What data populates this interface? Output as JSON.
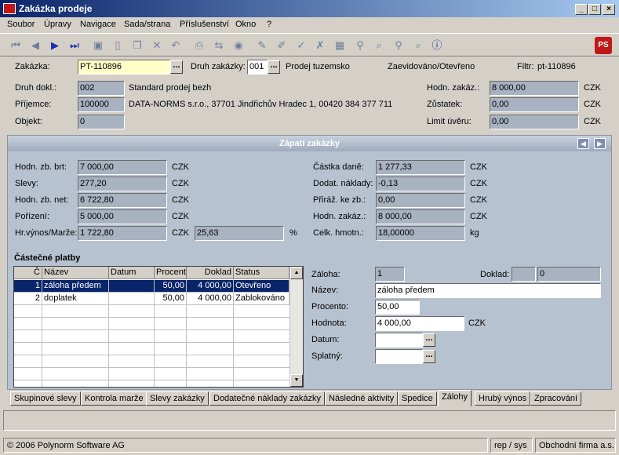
{
  "window": {
    "title": "Zakázka prodeje"
  },
  "menu": [
    "Soubor",
    "Úpravy",
    "Navigace",
    "Sada/strana",
    "Příslušenství",
    "Okno",
    "?"
  ],
  "header": {
    "zakazka_label": "Zakázka:",
    "zakazka_value": "PT-110896",
    "druh_zakazky_label": "Druh zakázky:",
    "druh_zakazky_value": "001",
    "druh_zakazky_text": "Prodej tuzemsko",
    "status_text": "Zaevidováno/Otevřeno",
    "filtr_label": "Filtr:",
    "filtr_value": "pt-110896",
    "druh_dokl_label": "Druh dokl.:",
    "druh_dokl_value": "002",
    "druh_dokl_text": "Standard prodej bezh",
    "prijemce_label": "Příjemce:",
    "prijemce_value": "100000",
    "prijemce_text": "DATA-NORMS s.r.o., 37701 Jindřichův Hradec 1, 00420 384 377 711",
    "objekt_label": "Objekt:",
    "objekt_value": "0",
    "hodn_zakaz_label": "Hodn. zakáz.:",
    "hodn_zakaz_value": "8 000,00",
    "zustatek_label": "Zůstatek:",
    "zustatek_value": "0,00",
    "limit_uveru_label": "Limit úvěru:",
    "limit_uveru_value": "0,00",
    "currency": "CZK"
  },
  "footer_panel": {
    "title": "Zápatí zakázky",
    "left": [
      {
        "label": "Hodn. zb. brt:",
        "value": "7 000,00",
        "unit": "CZK"
      },
      {
        "label": "Slevy:",
        "value": "277,20",
        "unit": "CZK"
      },
      {
        "label": "Hodn. zb. net:",
        "value": "6 722,80",
        "unit": "CZK"
      },
      {
        "label": "Pořízení:",
        "value": "5 000,00",
        "unit": "CZK"
      },
      {
        "label": "Hr.výnos/Marže:",
        "value": "1 722,80",
        "unit": "CZK"
      }
    ],
    "marze_pct": "25,63",
    "pct_sign": "%",
    "right": [
      {
        "label": "Částka daně:",
        "value": "1 277,33",
        "unit": "CZK"
      },
      {
        "label": "Dodat. náklady:",
        "value": "-0,13",
        "unit": "CZK"
      },
      {
        "label": "Přiráž. ke zb.:",
        "value": "0,00",
        "unit": "CZK"
      },
      {
        "label": "Hodn. zakáz.:",
        "value": "8 000,00",
        "unit": "CZK"
      },
      {
        "label": "Celk. hmotn.:",
        "value": "18,00000",
        "unit": "kg"
      }
    ]
  },
  "partial": {
    "title": "Částečné platby",
    "columns": [
      "Č",
      "Název",
      "Datum",
      "Procent",
      "Doklad",
      "Status"
    ],
    "rows": [
      {
        "c": "1",
        "nazev": "záloha předem",
        "datum": "",
        "procent": "50,00",
        "doklad": "4 000,00",
        "status": "Otevřeno"
      },
      {
        "c": "2",
        "nazev": "doplatek",
        "datum": "",
        "procent": "50,00",
        "doklad": "4 000,00",
        "status": "Zablokováno"
      }
    ]
  },
  "detail": {
    "zaloha_label": "Záloha:",
    "zaloha_value": "1",
    "doklad_label": "Doklad:",
    "doklad_value1": "",
    "doklad_value2": "0",
    "nazev_label": "Název:",
    "nazev_value": "záloha předem",
    "procento_label": "Procento:",
    "procento_value": "50,00",
    "hodnota_label": "Hodnota:",
    "hodnota_value": "4 000,00",
    "hodnota_unit": "CZK",
    "datum_label": "Datum:",
    "datum_value": "",
    "splatny_label": "Splatný:",
    "splatny_value": ""
  },
  "tabs": [
    {
      "label": "Skupinové slevy",
      "active": false
    },
    {
      "label": "Kontrola marže",
      "active": false
    },
    {
      "label": "Slevy zakázky",
      "active": false
    },
    {
      "label": "Dodatečné náklady zakázky",
      "active": false
    },
    {
      "label": "Následné aktivity",
      "active": false
    },
    {
      "label": "Spedice",
      "active": false
    },
    {
      "label": "Zálohy",
      "active": true
    },
    {
      "label": "Hrubý výnos",
      "active": false
    },
    {
      "label": "Zpracování",
      "active": false
    }
  ],
  "status": {
    "copyright": "© 2006 Polynorm Software AG",
    "user": "rep / sys",
    "company": "Obchodní firma a.s."
  }
}
